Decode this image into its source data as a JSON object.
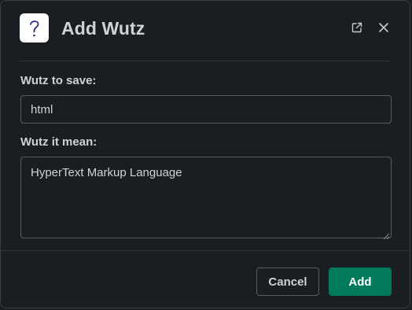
{
  "dialog": {
    "title": "Add Wutz",
    "app_icon": "question-mark-icon",
    "actions": {
      "external_icon": "external-link-icon",
      "close_icon": "close-icon"
    }
  },
  "form": {
    "term_label": "Wutz to save:",
    "term_value": "html",
    "meaning_label": "Wutz it mean:",
    "meaning_value": "HyperText Markup Language"
  },
  "footer": {
    "cancel_label": "Cancel",
    "add_label": "Add"
  },
  "colors": {
    "background": "#1a1d21",
    "text": "#d1d2d3",
    "primary": "#007a5a",
    "border": "#5a5d62"
  }
}
